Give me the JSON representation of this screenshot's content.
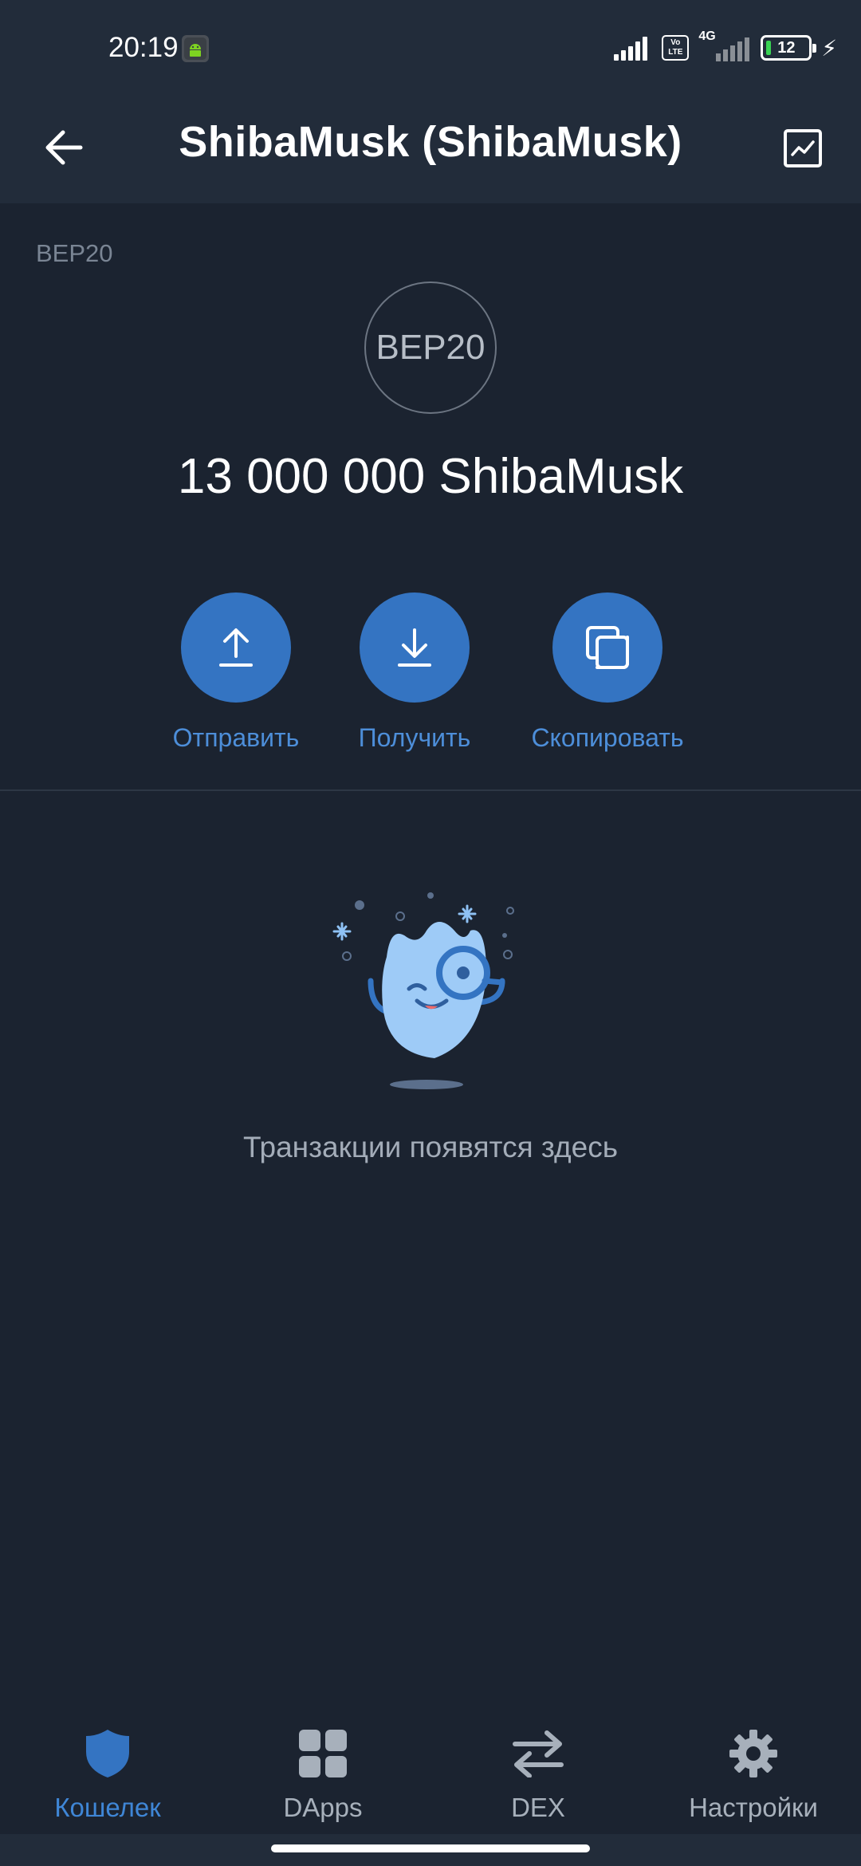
{
  "status_bar": {
    "time": "20:19",
    "volte_label": "Vo LTE",
    "network_label": "4G",
    "battery_level": "12",
    "charging": true
  },
  "header": {
    "title": "ShibaMusk (ShibaMusk)"
  },
  "token": {
    "network": "BEP20",
    "logo_text": "BEP20",
    "balance": "13 000 000 ShibaMusk"
  },
  "actions": [
    {
      "label": "Отправить",
      "icon": "upload-icon"
    },
    {
      "label": "Получить",
      "icon": "download-icon"
    },
    {
      "label": "Скопировать",
      "icon": "copy-icon"
    }
  ],
  "empty_state": {
    "text": "Транзакции появятся здесь"
  },
  "bottom_nav": {
    "items": [
      {
        "label": "Кошелек",
        "icon": "shield-icon",
        "active": true
      },
      {
        "label": "DApps",
        "icon": "grid-icon",
        "active": false
      },
      {
        "label": "DEX",
        "icon": "swap-arrows-icon",
        "active": false
      },
      {
        "label": "Настройки",
        "icon": "gear-icon",
        "active": false
      }
    ]
  },
  "colors": {
    "background": "#1b2330",
    "header": "#222c3a",
    "accent": "#3474c2",
    "accent_text": "#4d8ed9",
    "muted_text": "#a3acb8"
  }
}
